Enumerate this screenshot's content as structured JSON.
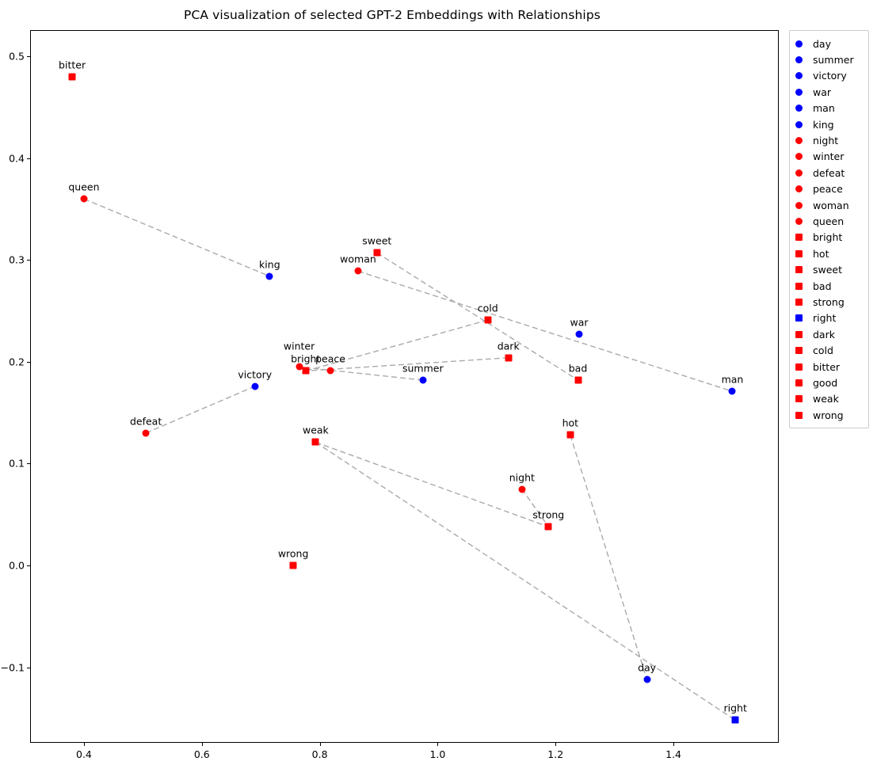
{
  "chart_data": {
    "type": "scatter",
    "title": "PCA visualization of selected GPT-2 Embeddings with Relationships",
    "xlabel": "",
    "ylabel": "",
    "xlim": [
      0.31,
      1.58
    ],
    "ylim": [
      -0.175,
      0.525
    ],
    "xticks": [
      "0.4",
      "0.6",
      "0.8",
      "1.0",
      "1.2",
      "1.4"
    ],
    "xtick_values": [
      0.4,
      0.6,
      0.8,
      1.0,
      1.2,
      1.4
    ],
    "yticks": [
      "0.5",
      "0.4",
      "0.3",
      "0.2",
      "0.1",
      "0.0",
      "−0.1"
    ],
    "ytick_values": [
      0.5,
      0.4,
      0.3,
      0.2,
      0.1,
      0.0,
      -0.1
    ],
    "grid": false,
    "legend_position": "upper right outside",
    "colors": {
      "blue": "#0000ff",
      "red": "#ff0000",
      "line": "#aaaaaa"
    },
    "points": [
      {
        "label": "bitter",
        "x": 0.38,
        "y": 0.48,
        "color": "#ff0000",
        "marker": "square",
        "label_dx": 0,
        "label_dy": -8
      },
      {
        "label": "queen",
        "x": 0.4,
        "y": 0.36,
        "color": "#ff0000",
        "marker": "circle",
        "label_dx": 0,
        "label_dy": -8
      },
      {
        "label": "defeat",
        "x": 0.505,
        "y": 0.13,
        "color": "#ff0000",
        "marker": "circle",
        "label_dx": 0,
        "label_dy": -8
      },
      {
        "label": "victory",
        "x": 0.69,
        "y": 0.176,
        "color": "#0000ff",
        "marker": "circle",
        "label_dx": 0,
        "label_dy": -8
      },
      {
        "label": "king",
        "x": 0.715,
        "y": 0.284,
        "color": "#0000ff",
        "marker": "circle",
        "label_dx": 0,
        "label_dy": -8
      },
      {
        "label": "wrong",
        "x": 0.755,
        "y": 0.0,
        "color": "#ff0000",
        "marker": "square",
        "label_dx": 0,
        "label_dy": -8
      },
      {
        "label": "winter",
        "x": 0.765,
        "y": 0.195,
        "color": "#ff0000",
        "marker": "circle",
        "label_dx": 0,
        "label_dy": -19
      },
      {
        "label": "bright",
        "x": 0.776,
        "y": 0.191,
        "color": "#ff0000",
        "marker": "square",
        "label_dx": 0,
        "label_dy": -8
      },
      {
        "label": "weak",
        "x": 0.793,
        "y": 0.121,
        "color": "#ff0000",
        "marker": "square",
        "label_dx": 0,
        "label_dy": -8
      },
      {
        "label": "peace",
        "x": 0.818,
        "y": 0.191,
        "color": "#ff0000",
        "marker": "circle",
        "label_dx": 0,
        "label_dy": -8
      },
      {
        "label": "woman",
        "x": 0.865,
        "y": 0.289,
        "color": "#ff0000",
        "marker": "circle",
        "label_dx": 0,
        "label_dy": -8
      },
      {
        "label": "sweet",
        "x": 0.897,
        "y": 0.307,
        "color": "#ff0000",
        "marker": "square",
        "label_dx": 0,
        "label_dy": -8
      },
      {
        "label": "summer",
        "x": 0.975,
        "y": 0.182,
        "color": "#0000ff",
        "marker": "circle",
        "label_dx": 0,
        "label_dy": -8
      },
      {
        "label": "cold",
        "x": 1.085,
        "y": 0.241,
        "color": "#ff0000",
        "marker": "square",
        "label_dx": 0,
        "label_dy": -8
      },
      {
        "label": "dark",
        "x": 1.12,
        "y": 0.204,
        "color": "#ff0000",
        "marker": "square",
        "label_dx": 0,
        "label_dy": -8
      },
      {
        "label": "night",
        "x": 1.143,
        "y": 0.075,
        "color": "#ff0000",
        "marker": "circle",
        "label_dx": 0,
        "label_dy": -8
      },
      {
        "label": "strong",
        "x": 1.188,
        "y": 0.038,
        "color": "#ff0000",
        "marker": "square",
        "label_dx": 0,
        "label_dy": -8
      },
      {
        "label": "hot",
        "x": 1.225,
        "y": 0.128,
        "color": "#ff0000",
        "marker": "square",
        "label_dx": 0,
        "label_dy": -8
      },
      {
        "label": "bad",
        "x": 1.238,
        "y": 0.182,
        "color": "#ff0000",
        "marker": "square",
        "label_dx": 0,
        "label_dy": -8
      },
      {
        "label": "war",
        "x": 1.24,
        "y": 0.227,
        "color": "#0000ff",
        "marker": "circle",
        "label_dx": 0,
        "label_dy": -8
      },
      {
        "label": "day",
        "x": 1.355,
        "y": -0.112,
        "color": "#0000ff",
        "marker": "circle",
        "label_dx": 0,
        "label_dy": -8
      },
      {
        "label": "man",
        "x": 1.5,
        "y": 0.171,
        "color": "#0000ff",
        "marker": "circle",
        "label_dx": 0,
        "label_dy": -8
      },
      {
        "label": "right",
        "x": 1.505,
        "y": -0.152,
        "color": "#0000ff",
        "marker": "square",
        "label_dx": 0,
        "label_dy": -8
      }
    ],
    "connections": [
      {
        "from": "queen",
        "to": "king"
      },
      {
        "from": "defeat",
        "to": "victory"
      },
      {
        "from": "woman",
        "to": "man"
      },
      {
        "from": "sweet",
        "to": "bad"
      },
      {
        "from": "cold",
        "to": "bright"
      },
      {
        "from": "dark",
        "to": "bright"
      },
      {
        "from": "summer",
        "to": "winter"
      },
      {
        "from": "night",
        "to": "strong"
      },
      {
        "from": "hot",
        "to": "day"
      },
      {
        "from": "weak",
        "to": "strong"
      },
      {
        "from": "weak",
        "to": "right"
      }
    ]
  },
  "legend": {
    "items": [
      {
        "label": "day",
        "color": "#0000ff",
        "marker": "circle"
      },
      {
        "label": "summer",
        "color": "#0000ff",
        "marker": "circle"
      },
      {
        "label": "victory",
        "color": "#0000ff",
        "marker": "circle"
      },
      {
        "label": "war",
        "color": "#0000ff",
        "marker": "circle"
      },
      {
        "label": "man",
        "color": "#0000ff",
        "marker": "circle"
      },
      {
        "label": "king",
        "color": "#0000ff",
        "marker": "circle"
      },
      {
        "label": "night",
        "color": "#ff0000",
        "marker": "circle"
      },
      {
        "label": "winter",
        "color": "#ff0000",
        "marker": "circle"
      },
      {
        "label": "defeat",
        "color": "#ff0000",
        "marker": "circle"
      },
      {
        "label": "peace",
        "color": "#ff0000",
        "marker": "circle"
      },
      {
        "label": "woman",
        "color": "#ff0000",
        "marker": "circle"
      },
      {
        "label": "queen",
        "color": "#ff0000",
        "marker": "circle"
      },
      {
        "label": "bright",
        "color": "#ff0000",
        "marker": "square"
      },
      {
        "label": "hot",
        "color": "#ff0000",
        "marker": "square"
      },
      {
        "label": "sweet",
        "color": "#ff0000",
        "marker": "square"
      },
      {
        "label": "bad",
        "color": "#ff0000",
        "marker": "square"
      },
      {
        "label": "strong",
        "color": "#ff0000",
        "marker": "square"
      },
      {
        "label": "right",
        "color": "#0000ff",
        "marker": "square"
      },
      {
        "label": "dark",
        "color": "#ff0000",
        "marker": "square"
      },
      {
        "label": "cold",
        "color": "#ff0000",
        "marker": "square"
      },
      {
        "label": "bitter",
        "color": "#ff0000",
        "marker": "square"
      },
      {
        "label": "good",
        "color": "#ff0000",
        "marker": "square"
      },
      {
        "label": "weak",
        "color": "#ff0000",
        "marker": "square"
      },
      {
        "label": "wrong",
        "color": "#ff0000",
        "marker": "square"
      }
    ]
  }
}
